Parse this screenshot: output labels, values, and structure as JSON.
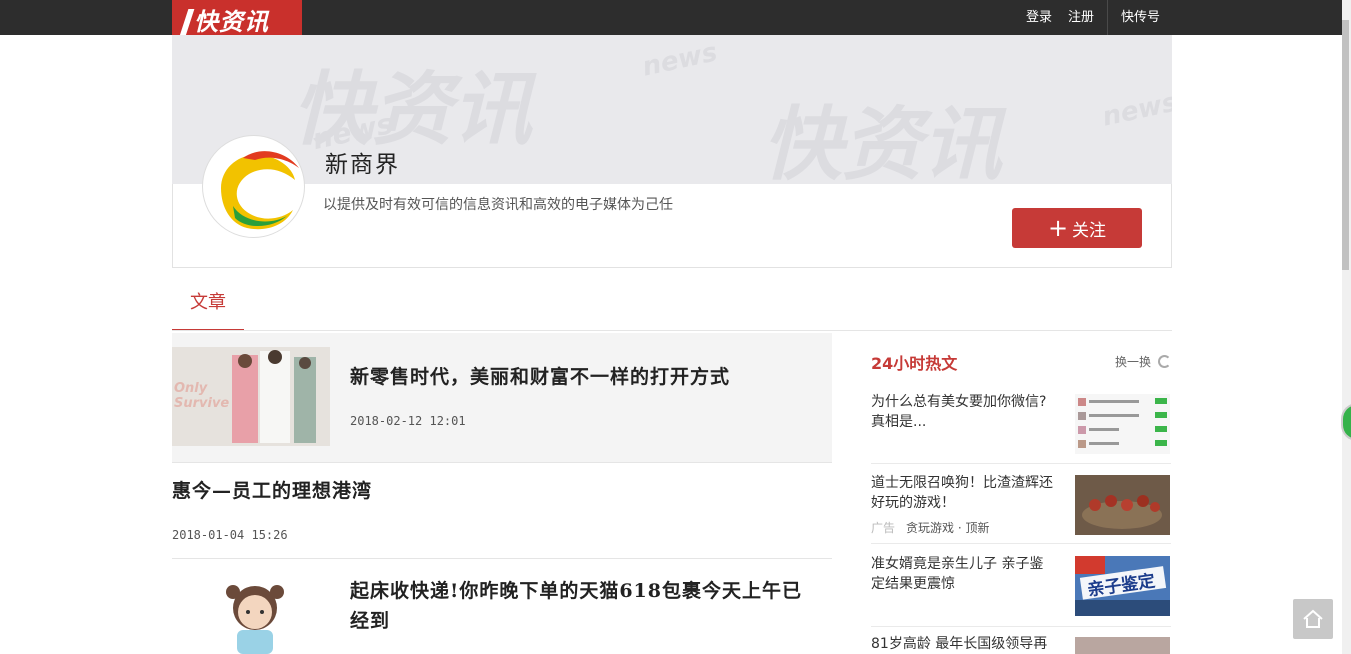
{
  "brand": {
    "logo_text": "快资讯"
  },
  "topnav": {
    "login": "登录",
    "register": "注册",
    "kuaichuanhao": "快传号"
  },
  "banner": {
    "watermark_main": "快资讯",
    "watermark_news": "news"
  },
  "profile": {
    "name": "新商界",
    "description": "以提供及时有效可信的信息资讯和高效的电子媒体为己任",
    "follow_label": "关注",
    "follow_plus": "+"
  },
  "tabs": {
    "articles": "文章"
  },
  "articles": [
    {
      "title": "新零售时代，美丽和财富不一样的打开方式",
      "date": "2018-02-12 12:01",
      "thumb_text": "Only Survive"
    },
    {
      "title": "惠今—员工的理想港湾",
      "date": "2018-01-04 15:26"
    },
    {
      "title_line1": "起床收快递!你昨晚下单的天猫618包裹今天上午已",
      "title_line2": "经到"
    }
  ],
  "hot": {
    "title": "24小时热文",
    "refresh_label": "换一换",
    "items": [
      {
        "line1": "为什么总有美女要加你微信?",
        "line2": "真相是..."
      },
      {
        "line1": "道士无限召唤狗！比渣渣辉还",
        "line2": "好玩的游戏！",
        "ad_tag": "广告",
        "source": "贪玩游戏 · 顶新"
      },
      {
        "line1": "准女婿竟是亲生儿子 亲子鉴",
        "line2": "定结果更震惊",
        "img_text": "亲子鉴定"
      },
      {
        "line1": "81岁高龄 最年长国级领导再"
      }
    ]
  },
  "colors": {
    "accent": "#c63a37",
    "topbar": "#2d2d2d"
  }
}
